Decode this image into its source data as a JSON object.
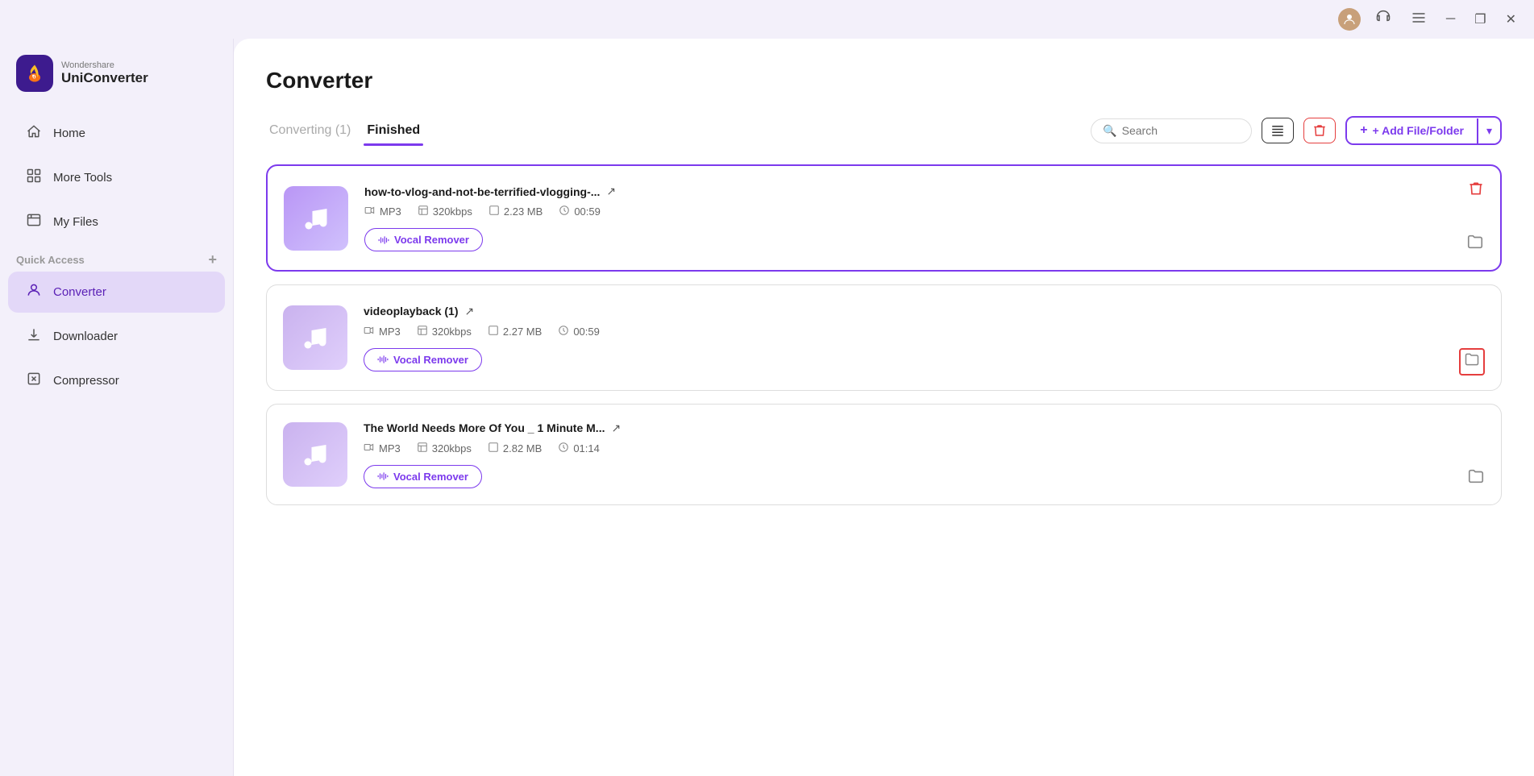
{
  "titlebar": {
    "minimize_label": "─",
    "maximize_label": "❐",
    "close_label": "✕"
  },
  "sidebar": {
    "logo": {
      "brand": "Wondershare",
      "product": "UniConverter",
      "icon": "🔥"
    },
    "nav_items": [
      {
        "id": "home",
        "label": "Home",
        "icon": "⌂"
      },
      {
        "id": "more-tools",
        "label": "More Tools",
        "icon": "▦"
      },
      {
        "id": "my-files",
        "label": "My Files",
        "icon": "☰"
      }
    ],
    "quick_access_label": "Quick Access",
    "quick_access_add": "+",
    "sub_nav_items": [
      {
        "id": "converter",
        "label": "Converter",
        "icon": "👤",
        "active": true
      },
      {
        "id": "downloader",
        "label": "Downloader",
        "icon": "⬇"
      },
      {
        "id": "compressor",
        "label": "Compressor",
        "icon": "🗜"
      }
    ]
  },
  "main": {
    "page_title": "Converter",
    "tabs": [
      {
        "id": "converting",
        "label": "Converting (1)",
        "active": false
      },
      {
        "id": "finished",
        "label": "Finished",
        "active": true
      }
    ],
    "search_placeholder": "Search",
    "add_file_label": "+ Add File/Folder",
    "files": [
      {
        "id": "file-1",
        "name": "how-to-vlog-and-not-be-terrified-vlogging-...",
        "format": "MP3",
        "bitrate": "320kbps",
        "size": "2.23 MB",
        "duration": "00:59",
        "vocal_btn": "Vocal Remover",
        "highlighted": true
      },
      {
        "id": "file-2",
        "name": "videoplayback (1)",
        "format": "MP3",
        "bitrate": "320kbps",
        "size": "2.27 MB",
        "duration": "00:59",
        "vocal_btn": "Vocal Remover",
        "highlighted": false,
        "folder_highlighted": true
      },
      {
        "id": "file-3",
        "name": "The World Needs More Of You _ 1 Minute M...",
        "format": "MP3",
        "bitrate": "320kbps",
        "size": "2.82 MB",
        "duration": "01:14",
        "vocal_btn": "Vocal Remover",
        "highlighted": false
      }
    ]
  }
}
